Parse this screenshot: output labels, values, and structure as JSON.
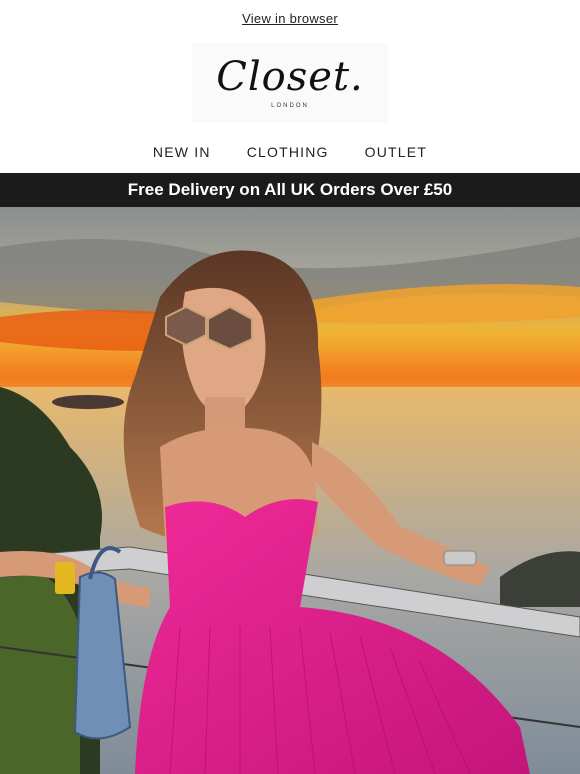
{
  "top_link": "View in browser",
  "logo": {
    "script": "Closet.",
    "subtitle": "LONDON"
  },
  "nav": {
    "items": [
      "NEW IN",
      "CLOTHING",
      "OUTLET"
    ]
  },
  "banner": {
    "text": "Free Delivery on All UK Orders Over £50"
  },
  "hero": {
    "image_icon": "hero-photo"
  },
  "colors": {
    "banner_bg": "#1b1b1b",
    "dress": "#e01c8c",
    "sky_orange": "#f27b1e"
  }
}
